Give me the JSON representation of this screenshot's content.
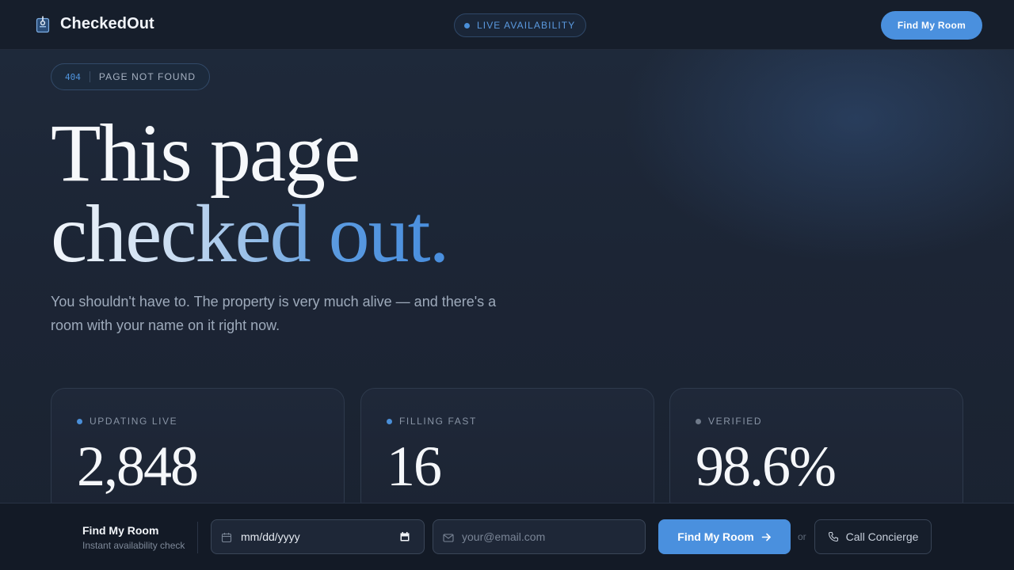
{
  "app": {
    "name": "CheckedOut"
  },
  "header": {
    "live_label": "LIVE AVAILABILITY",
    "cta_label": "Find My Room"
  },
  "error_badge": {
    "code": "404",
    "text": "PAGE NOT FOUND"
  },
  "hero": {
    "line1": "This page",
    "line2": "checked out.",
    "subtitle": "You shouldn't have to. The property is very much alive — and there's a room with your name on it right now."
  },
  "stats": [
    {
      "label": "UPDATING LIVE",
      "value": "2,848",
      "dot_color": "#4a8fd8"
    },
    {
      "label": "FILLING FAST",
      "value": "16",
      "dot_color": "#4a8fd8"
    },
    {
      "label": "VERIFIED",
      "value": "98.6%",
      "dot_color": "#6f7a8a"
    }
  ],
  "booking_bar": {
    "title": "Find My Room",
    "subtitle": "Instant availability check",
    "date_value": "mm/dd/yyyy",
    "email_placeholder": "your@email.com",
    "submit_label": "Find My Room",
    "or_label": "or",
    "call_label": "Call Concierge"
  },
  "colors": {
    "accent": "#4a90de",
    "background": "#1b2332",
    "bar_background": "#131a26"
  },
  "icons": {
    "logo": "door-hanger-icon",
    "date": "calendar-icon",
    "email": "mail-icon",
    "submit": "arrow-right-icon",
    "call": "phone-icon"
  }
}
